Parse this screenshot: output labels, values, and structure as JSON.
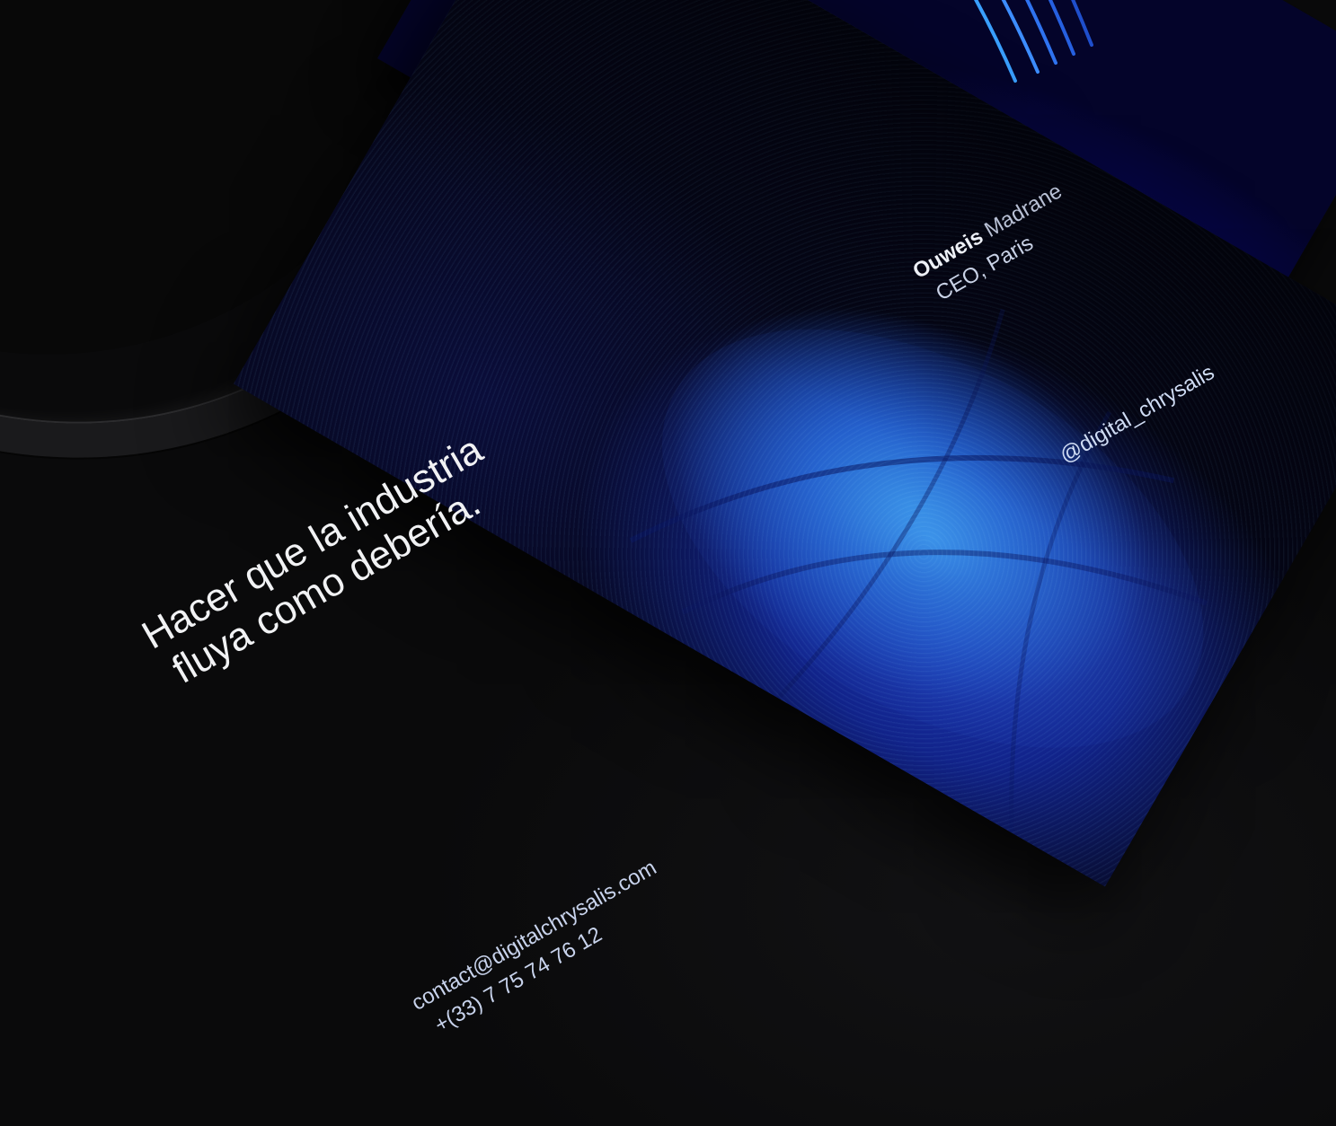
{
  "card": {
    "tagline": [
      "Hacer que la industria",
      "fluya como debería."
    ],
    "name_first": "Ouweis",
    "name_last": "Madrane",
    "role": "CEO, Paris",
    "email": "contact@digitalchrysalis.com",
    "phone": "+(33) 7 75 74 76 12",
    "handle": "@digital_chrysalis"
  },
  "colors": {
    "background": "#0b0b0c",
    "card_blue": "#1b52c2",
    "card_deep": "#050618",
    "text": "#e9ecf3"
  }
}
